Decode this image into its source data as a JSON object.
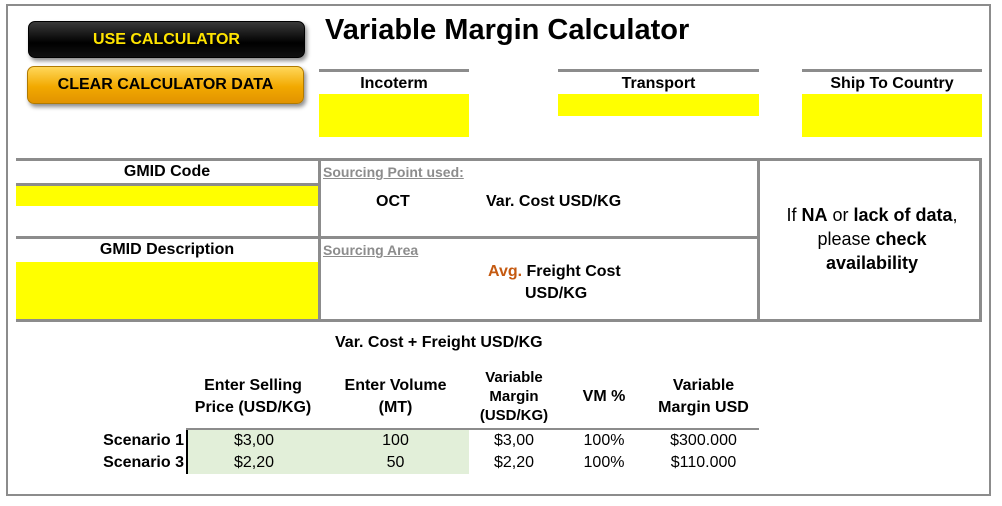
{
  "buttons": {
    "use_calculator": "USE CALCULATOR",
    "clear_calculator": "CLEAR CALCULATOR DATA"
  },
  "title": "Variable Margin Calculator",
  "fields": {
    "incoterm": "Incoterm",
    "transport": "Transport",
    "ship_to_country": "Ship To Country",
    "gmid_code": "GMID Code",
    "gmid_description": "GMID Description"
  },
  "sourcing": {
    "point_label": "Sourcing Point used:",
    "point_value": "OCT",
    "var_cost_label": "Var. Cost USD/KG",
    "area_label": "Sourcing Area",
    "avg_word": "Avg.",
    "freight_cost_line1": "Freight Cost",
    "freight_cost_line2": "USD/KG"
  },
  "note": {
    "p1": "If ",
    "p2": "NA",
    "p3": " or ",
    "p4": "lack of data",
    "p5": ",",
    "p6": "please ",
    "p7": "check",
    "p8": "availability"
  },
  "summary_label": "Var. Cost + Freight USD/KG",
  "table": {
    "headers": {
      "price_l1": "Enter Selling",
      "price_l2": "Price (USD/KG)",
      "volume_l1": "Enter Volume",
      "volume_l2": "(MT)",
      "vm_l1": "Variable",
      "vm_l2": "Margin",
      "vm_l3": "(USD/KG)",
      "vm_pct": "VM %",
      "vm_usd_l1": "Variable",
      "vm_usd_l2": "Margin USD"
    },
    "rows": [
      {
        "label": "Scenario 1",
        "price": "$3,00",
        "volume": "100",
        "vm": "$3,00",
        "pct": "100%",
        "usd": "$300.000"
      },
      {
        "label": "Scenario 3",
        "price": "$2,20",
        "volume": "50",
        "vm": "$2,20",
        "pct": "100%",
        "usd": "$110.000"
      }
    ]
  },
  "colors": {
    "input_yellow": "#ffff00",
    "input_green": "#e2efd9",
    "accent_orange": "#c55a11",
    "border_gray": "#8c8c8c"
  }
}
